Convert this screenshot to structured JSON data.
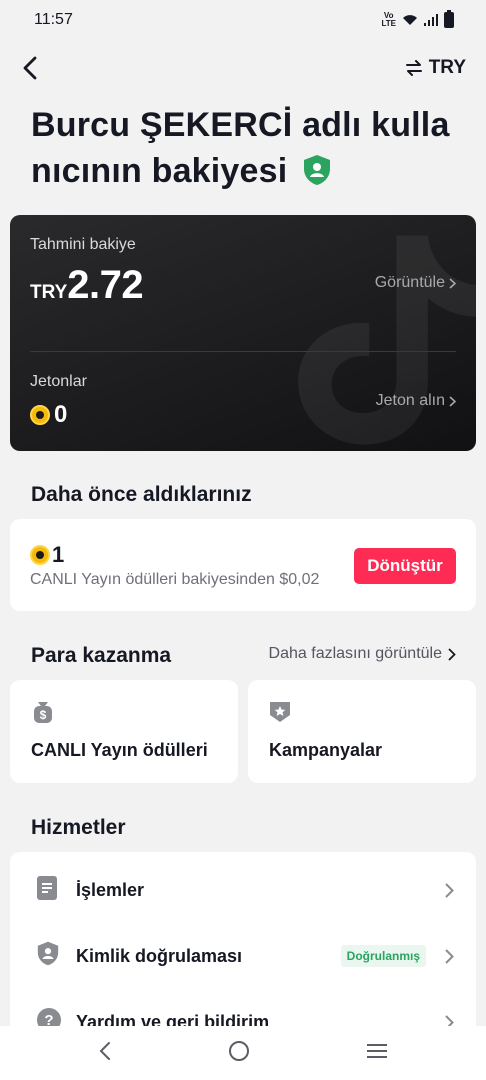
{
  "status_bar": {
    "time": "11:57",
    "network_label": "VoLTE"
  },
  "header": {
    "back_icon": "chevron-left-icon",
    "currency_toggle_label": "TRY",
    "currency_icon": "swap-arrows-icon"
  },
  "page": {
    "title": "Burcu ŞEKERCİ adlı kullanıcının bakiyesi",
    "verified_icon": "shield-user-icon"
  },
  "balance_card": {
    "estimated_label": "Tahmini bakiye",
    "currency": "TRY",
    "amount": "2.72",
    "view_link": "Görüntüle",
    "coins_label": "Jetonlar",
    "coins_value": "0",
    "get_coins_link": "Jeton alın"
  },
  "previously_received": {
    "title": "Daha önce aldıklarınız",
    "coin_count": "1",
    "description": "CANLI Yayın ödülleri bakiyesinden $0,02",
    "convert_button": "Dönüştür"
  },
  "monetization": {
    "title": "Para kazanma",
    "more_link": "Daha fazlasını görüntüle",
    "cards": [
      {
        "label": "CANLI Yayın ödülleri",
        "icon": "money-bag-icon"
      },
      {
        "label": "Kampanyalar",
        "icon": "badge-star-icon"
      }
    ]
  },
  "services": {
    "title": "Hizmetler",
    "items": [
      {
        "label": "İşlemler",
        "icon": "document-icon"
      },
      {
        "label": "Kimlik doğrulaması",
        "icon": "shield-user-icon",
        "badge": "Doğrulanmış"
      },
      {
        "label": "Yardım ve geri bildirim",
        "icon": "question-icon"
      }
    ]
  },
  "colors": {
    "accent": "#fe2c55",
    "verified": "#2aa45e",
    "card_dark": "#1c1c1e"
  }
}
